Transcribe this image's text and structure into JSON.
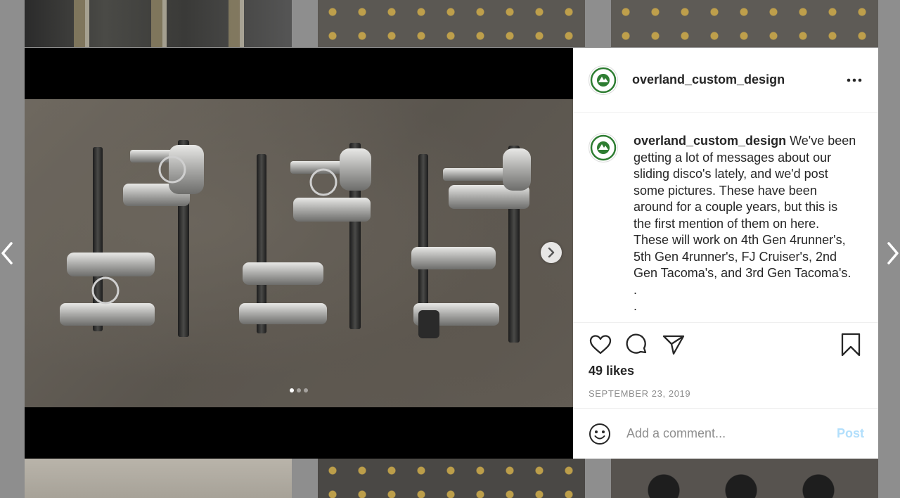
{
  "post": {
    "username": "overland_custom_design",
    "caption_lines": [
      "We've been",
      "getting a lot of messages about our",
      "sliding disco's lately, and we'd post",
      "some pictures. These have been",
      "around for a couple years, but this is",
      "the first mention of them on here.",
      "These will work on 4th Gen 4runner's,",
      "5th Gen 4runner's, FJ Cruiser's, 2nd",
      "Gen Tacoma's, and 3rd Gen Tacoma's.",
      ".",
      "."
    ],
    "likes": "49 likes",
    "date": "SEPTEMBER 23, 2019",
    "carousel": {
      "count": 3,
      "active": 0
    }
  },
  "comment": {
    "placeholder": "Add a comment...",
    "post_label": "Post"
  },
  "icons": {
    "more": "more-options-icon",
    "like": "heart-icon",
    "comment": "comment-bubble-icon",
    "share": "paper-plane-icon",
    "save": "bookmark-icon",
    "emoji": "smiley-icon",
    "next": "chevron-right-icon",
    "prev": "chevron-left-icon"
  },
  "colors": {
    "text": "#262626",
    "muted": "#8e8e8e",
    "post_disabled": "#b2dffc",
    "logo_green": "#2e7d32"
  }
}
